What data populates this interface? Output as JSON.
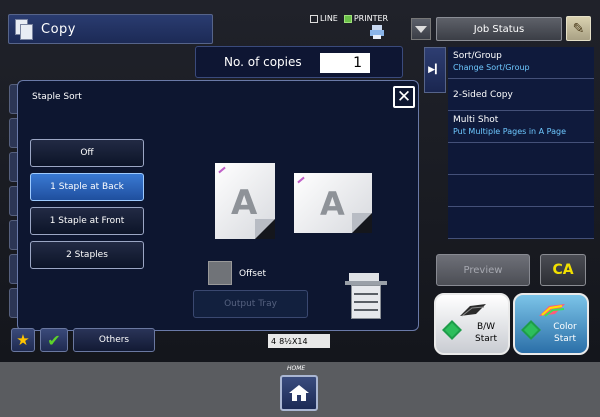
{
  "header": {
    "title": "Copy",
    "line_label": "LINE",
    "printer_label": "PRINTER",
    "job_status_label": "Job Status"
  },
  "copies": {
    "label": "No. of copies",
    "value": "1"
  },
  "right_panel": {
    "items": [
      {
        "title": "Sort/Group",
        "sub": "Change Sort/Group"
      },
      {
        "title": "2-Sided Copy",
        "sub": ""
      },
      {
        "title": "Multi Shot",
        "sub": "Put Multiple Pages in A Page"
      }
    ]
  },
  "dialog": {
    "title": "Staple Sort",
    "close_glyph": "✕",
    "options": [
      {
        "label": "Off",
        "selected": false
      },
      {
        "label": "1 Staple at Back",
        "selected": true
      },
      {
        "label": "1 Staple at Front",
        "selected": false
      },
      {
        "label": "2 Staples",
        "selected": false
      }
    ],
    "paper_letter": "A",
    "offset_label": "Offset",
    "output_tray_label": "Output Tray"
  },
  "bottom": {
    "others_label": "Others",
    "paper_tag": "8½X14",
    "paper_tray_number": "4"
  },
  "controls": {
    "preview_label": "Preview",
    "ca_label": "CA",
    "bw_start_line1": "B/W",
    "bw_start_line2": "Start",
    "color_start_line1": "Color",
    "color_start_line2": "Start"
  },
  "home": {
    "label": "HOME"
  },
  "colors": {
    "selected_option": "#2f66c0",
    "sub_text": "#6ec8ff",
    "ca_text": "#f2e000",
    "start_green": "#2dbe5c"
  }
}
